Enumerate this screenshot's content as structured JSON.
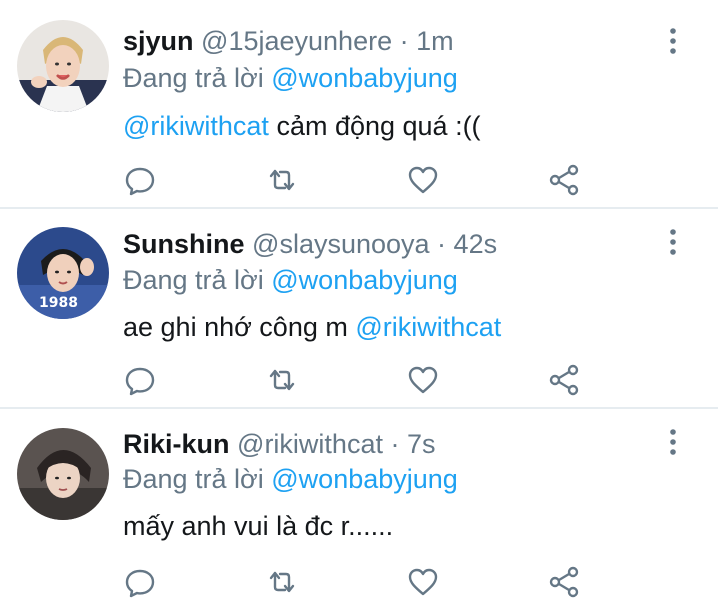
{
  "tweets": [
    {
      "name": "sjyun",
      "handle": "@15jaeyunhere",
      "separator": " · ",
      "time": "1m",
      "reply_prefix": "Đang trả lời ",
      "reply_to": "@wonbabyjung",
      "mention": "@rikiwithcat",
      "text_after": " cảm động quá :((",
      "text_before": ""
    },
    {
      "name": "Sunshine",
      "handle": "@slaysunooya",
      "separator": " · ",
      "time": "42s",
      "reply_prefix": "Đang trả lời ",
      "reply_to": "@wonbabyjung",
      "text_before": "ae ghi nhớ công m ",
      "mention": "@rikiwithcat",
      "text_after": ""
    },
    {
      "name": "Riki-kun",
      "handle": "@rikiwithcat",
      "separator": " · ",
      "time": "7s",
      "reply_prefix": "Đang trả lời ",
      "reply_to": "@wonbabyjung",
      "text_before": "mấy anh vui là đc r......",
      "mention": "",
      "text_after": ""
    }
  ],
  "icons": {
    "more": "more-vertical-icon",
    "reply": "reply-bubble-icon",
    "retweet": "retweet-icon",
    "like": "heart-icon",
    "share": "share-icon"
  },
  "colors": {
    "accent": "#1da1f2",
    "muted": "#657786",
    "text": "#14171a",
    "divider": "#e6ecf0"
  }
}
